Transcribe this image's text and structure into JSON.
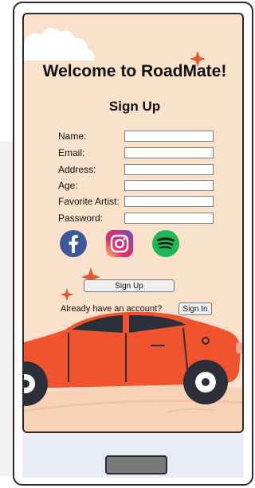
{
  "app": {
    "title": "Welcome to RoadMate!",
    "subtitle": "Sign Up"
  },
  "form": {
    "fields": [
      {
        "label": "Name:",
        "value": ""
      },
      {
        "label": "Email:",
        "value": ""
      },
      {
        "label": "Address:",
        "value": ""
      },
      {
        "label": "Age:",
        "value": ""
      },
      {
        "label": "Favorite Artist:",
        "value": ""
      },
      {
        "label": "Password:",
        "value": ""
      }
    ],
    "signup_button": "Sign Up"
  },
  "social": [
    "facebook-icon",
    "instagram-icon",
    "spotify-icon"
  ],
  "signin": {
    "prompt": "Already have an account?",
    "button": "Sign In"
  },
  "colors": {
    "background": "#fae1cc",
    "car": "#f0532e",
    "star": "#e4572e",
    "facebook": "#3b5998",
    "instagram": "#c13584",
    "spotify": "#1db954"
  }
}
